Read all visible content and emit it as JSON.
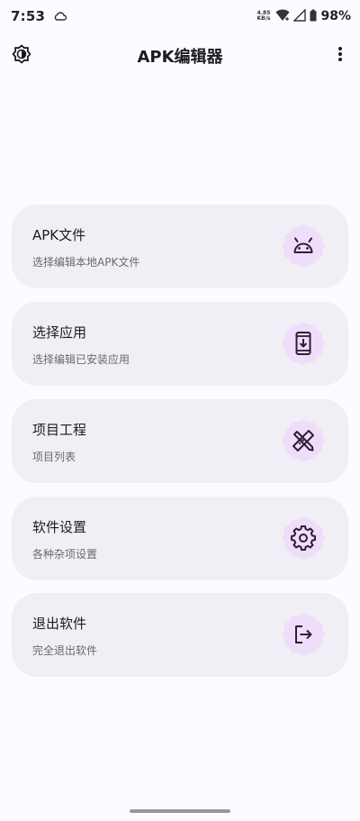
{
  "status_bar": {
    "time": "7:53",
    "net_speed_value": "4.85",
    "net_speed_unit": "KB/s",
    "battery": "98%"
  },
  "app_bar": {
    "title": "APK编辑器"
  },
  "menu": [
    {
      "title": "APK文件",
      "subtitle": "选择编辑本地APK文件",
      "icon": "android-icon"
    },
    {
      "title": "选择应用",
      "subtitle": "选择编辑已安装应用",
      "icon": "phone-download-icon"
    },
    {
      "title": "项目工程",
      "subtitle": "项目列表",
      "icon": "design-tools-icon"
    },
    {
      "title": "软件设置",
      "subtitle": "各种杂项设置",
      "icon": "gear-icon"
    },
    {
      "title": "退出软件",
      "subtitle": "完全退出软件",
      "icon": "logout-icon"
    }
  ],
  "colors": {
    "background": "#fdfbff",
    "card": "#f1eff6",
    "icon_badge": "#f0dcfb",
    "icon_stroke": "#2a2233"
  }
}
